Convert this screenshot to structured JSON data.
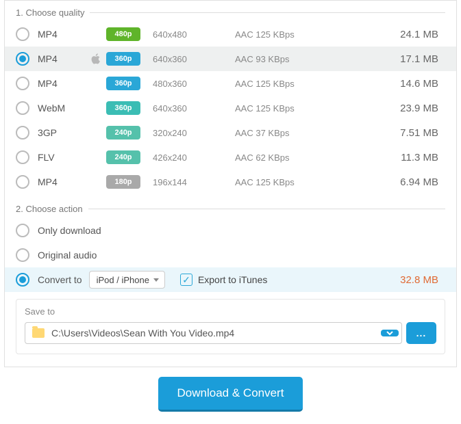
{
  "section1_title": "1. Choose quality",
  "section2_title": "2. Choose action",
  "badge_colors": {
    "480p": "#5fb42a",
    "360p_blue": "#2aa7d7",
    "360p_teal": "#3bbdb4",
    "240p": "#55c1ab",
    "180p": "#a9a9a9"
  },
  "quality_rows": [
    {
      "format": "MP4",
      "icon": "",
      "badge": "480p",
      "badge_color_key": "480p",
      "res": "640x480",
      "codec": "AAC 125  KBps",
      "size": "24.1 MB",
      "selected": false
    },
    {
      "format": "MP4",
      "icon": "apple",
      "badge": "360p",
      "badge_color_key": "360p_blue",
      "res": "640x360",
      "codec": "AAC 93  KBps",
      "size": "17.1 MB",
      "selected": true
    },
    {
      "format": "MP4",
      "icon": "",
      "badge": "360p",
      "badge_color_key": "360p_blue",
      "res": "480x360",
      "codec": "AAC 125  KBps",
      "size": "14.6 MB",
      "selected": false
    },
    {
      "format": "WebM",
      "icon": "",
      "badge": "360p",
      "badge_color_key": "360p_teal",
      "res": "640x360",
      "codec": "AAC 125  KBps",
      "size": "23.9 MB",
      "selected": false
    },
    {
      "format": "3GP",
      "icon": "",
      "badge": "240p",
      "badge_color_key": "240p",
      "res": "320x240",
      "codec": "AAC 37  KBps",
      "size": "7.51 MB",
      "selected": false
    },
    {
      "format": "FLV",
      "icon": "",
      "badge": "240p",
      "badge_color_key": "240p",
      "res": "426x240",
      "codec": "AAC 62  KBps",
      "size": "11.3 MB",
      "selected": false
    },
    {
      "format": "MP4",
      "icon": "",
      "badge": "180p",
      "badge_color_key": "180p",
      "res": "196x144",
      "codec": "AAC 125  KBps",
      "size": "6.94 MB",
      "selected": false
    }
  ],
  "actions": {
    "only_download": "Only download",
    "original_audio": "Original audio",
    "convert_to": "Convert to",
    "convert_target": "iPod / iPhone",
    "export_itunes": "Export to iTunes",
    "export_checked": true,
    "selected": "convert_to",
    "result_size": "32.8 MB"
  },
  "save": {
    "label": "Save to",
    "path": "C:\\Users\\Videos\\Sean With You Video.mp4",
    "browse": "..."
  },
  "main_button": "Download & Convert"
}
